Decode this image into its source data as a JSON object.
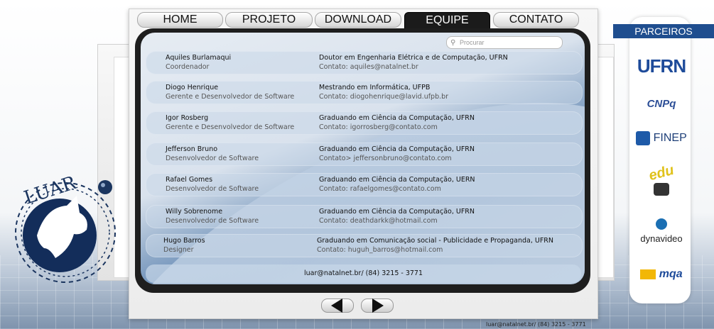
{
  "nav": {
    "tabs": [
      {
        "label": "HOME"
      },
      {
        "label": "PROJETO"
      },
      {
        "label": "DOWNLOAD"
      },
      {
        "label": "EQUIPE"
      },
      {
        "label": "CONTATO"
      }
    ]
  },
  "search": {
    "placeholder": "Procurar"
  },
  "team": [
    {
      "name": "Aquiles Burlamaqui",
      "role": "Coordenador",
      "degree": "Doutor em Engenharia Elétrica e de Computação, UFRN",
      "contact": "Contato: aquiles@natalnet.br"
    },
    {
      "name": "Diogo Henrique",
      "role": "Gerente e Desenvolvedor de Software",
      "degree": "Mestrando em Informática, UFPB",
      "contact": "Contato: diogohenrique@lavid.ufpb.br"
    },
    {
      "name": "Igor Rosberg",
      "role": "Gerente e Desenvolvedor de Software",
      "degree": "Graduando em Ciência da Computação, UFRN",
      "contact": "Contato: igorrosberg@contato.com"
    },
    {
      "name": "Jefferson Bruno",
      "role": "Desenvolvedor de Software",
      "degree": "Graduando em Ciência da Computação, UFRN",
      "contact": "Contato> jeffersonbruno@contato.com"
    },
    {
      "name": "Rafael Gomes",
      "role": "Desenvolvedor de Software",
      "degree": "Graduando em Ciência da Computação, UERN",
      "contact": "Contato: rafaelgomes@contato.com"
    },
    {
      "name": "Willy Sobrenome",
      "role": "Desenvolvedor de Software",
      "degree": "Graduando em Ciência da Computação, UFRN",
      "contact": "Contato: deathdarkk@hotmail.com"
    },
    {
      "name": "Hugo Barros",
      "role": "Designer",
      "degree": "Graduando em Comunicação social - Publicidade e Propaganda, UFRN",
      "contact": "Contato: huguh_barros@hotmail.com"
    }
  ],
  "footer": {
    "contact": "luar@natalnet.br/ (84) 3215 - 3771"
  },
  "bottom_contact": "luar@natalnet.br/ (84) 3215 - 3771",
  "logo": {
    "text": "LUAR"
  },
  "partners": {
    "title": "PARCEIROS",
    "items": [
      {
        "name": "UFRN"
      },
      {
        "name": "CNPq"
      },
      {
        "name": "FINEP"
      },
      {
        "name": "edu"
      },
      {
        "name": "dynavideo"
      },
      {
        "name": "mqa"
      }
    ]
  },
  "colors": {
    "accent": "#1f4e8f",
    "tab_active": "#1b1b1b"
  }
}
